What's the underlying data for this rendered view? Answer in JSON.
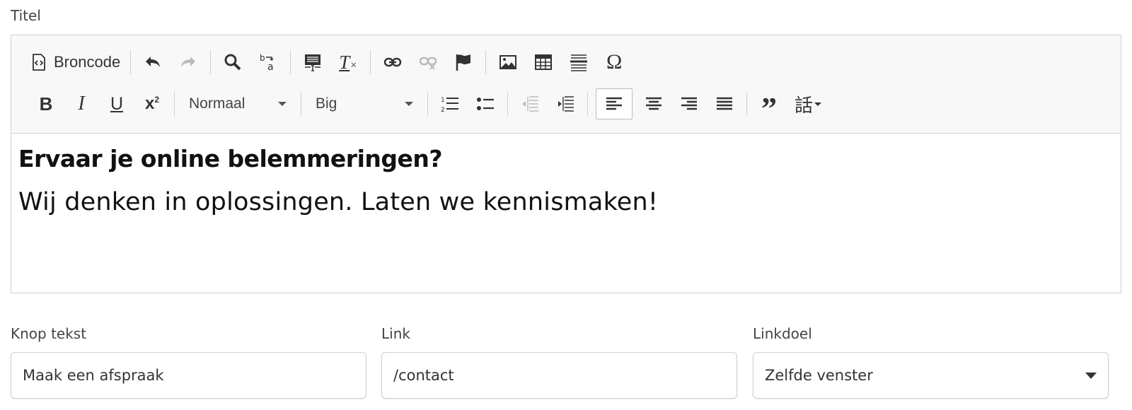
{
  "title_label": "Titel",
  "toolbar": {
    "source_label": "Broncode",
    "format_value": "Normaal",
    "size_value": "Big"
  },
  "content": {
    "heading": "Ervaar je online belemmeringen?",
    "paragraph": "Wij denken in oplossingen. Laten we kennismaken!"
  },
  "fields": {
    "button_text": {
      "label": "Knop tekst",
      "value": "Maak een afspraak"
    },
    "link": {
      "label": "Link",
      "value": "/contact"
    },
    "target": {
      "label": "Linkdoel",
      "value": "Zelfde venster"
    }
  }
}
